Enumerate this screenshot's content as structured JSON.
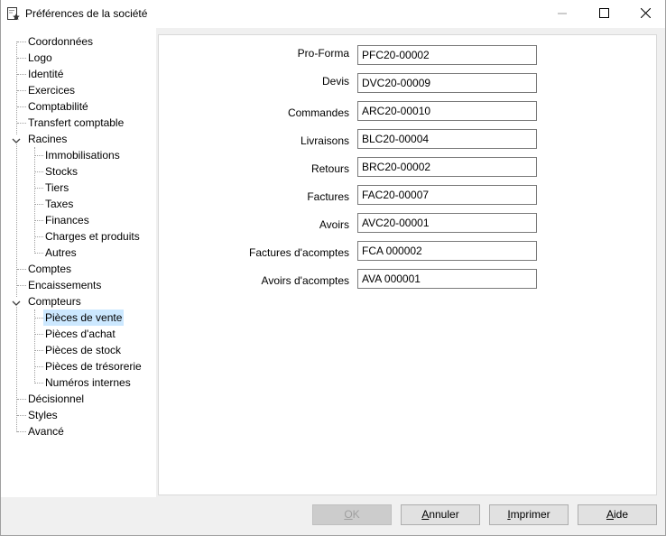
{
  "window": {
    "title": "Préférences de la société"
  },
  "tree": {
    "items": [
      {
        "label": "Coordonnées"
      },
      {
        "label": "Logo"
      },
      {
        "label": "Identité"
      },
      {
        "label": "Exercices"
      },
      {
        "label": "Comptabilité"
      },
      {
        "label": "Transfert comptable"
      },
      {
        "label": "Racines",
        "expanded": true
      },
      {
        "label": "Immobilisations"
      },
      {
        "label": "Stocks"
      },
      {
        "label": "Tiers"
      },
      {
        "label": "Taxes"
      },
      {
        "label": "Finances"
      },
      {
        "label": "Charges et produits"
      },
      {
        "label": "Autres"
      },
      {
        "label": "Comptes"
      },
      {
        "label": "Encaissements"
      },
      {
        "label": "Compteurs",
        "expanded": true
      },
      {
        "label": "Pièces de vente",
        "selected": true
      },
      {
        "label": "Pièces d'achat"
      },
      {
        "label": "Pièces de stock"
      },
      {
        "label": "Pièces de trésorerie"
      },
      {
        "label": "Numéros internes"
      },
      {
        "label": "Décisionnel"
      },
      {
        "label": "Styles"
      },
      {
        "label": "Avancé"
      }
    ]
  },
  "fields": [
    {
      "label": "Pro-Forma",
      "value": "PFC20-00002"
    },
    {
      "label": "Devis",
      "value": "DVC20-00009"
    },
    {
      "label": "Commandes",
      "value": "ARC20-00010"
    },
    {
      "label": "Livraisons",
      "value": "BLC20-00004"
    },
    {
      "label": "Retours",
      "value": "BRC20-00002"
    },
    {
      "label": "Factures",
      "value": "FAC20-00007"
    },
    {
      "label": "Avoirs",
      "value": "AVC20-00001"
    },
    {
      "label": "Factures d'acomptes",
      "value": "FCA 000002"
    },
    {
      "label": "Avoirs d'acomptes",
      "value": "AVA 000001"
    }
  ],
  "buttons": {
    "ok": {
      "first": "O",
      "rest": "K"
    },
    "cancel": {
      "first": "A",
      "rest": "nnuler"
    },
    "print": {
      "first": "I",
      "rest": "mprimer"
    },
    "help": {
      "first": "A",
      "rest": "ide"
    }
  },
  "colors": {
    "selection": "#cce8ff",
    "panel_bg": "#ffffff",
    "window_bg": "#f0f0f0"
  },
  "icons": {
    "title": "settings-document-icon",
    "minimize": "minimize-icon",
    "maximize": "maximize-icon",
    "close": "close-icon",
    "expander": "chevron-down-icon"
  }
}
